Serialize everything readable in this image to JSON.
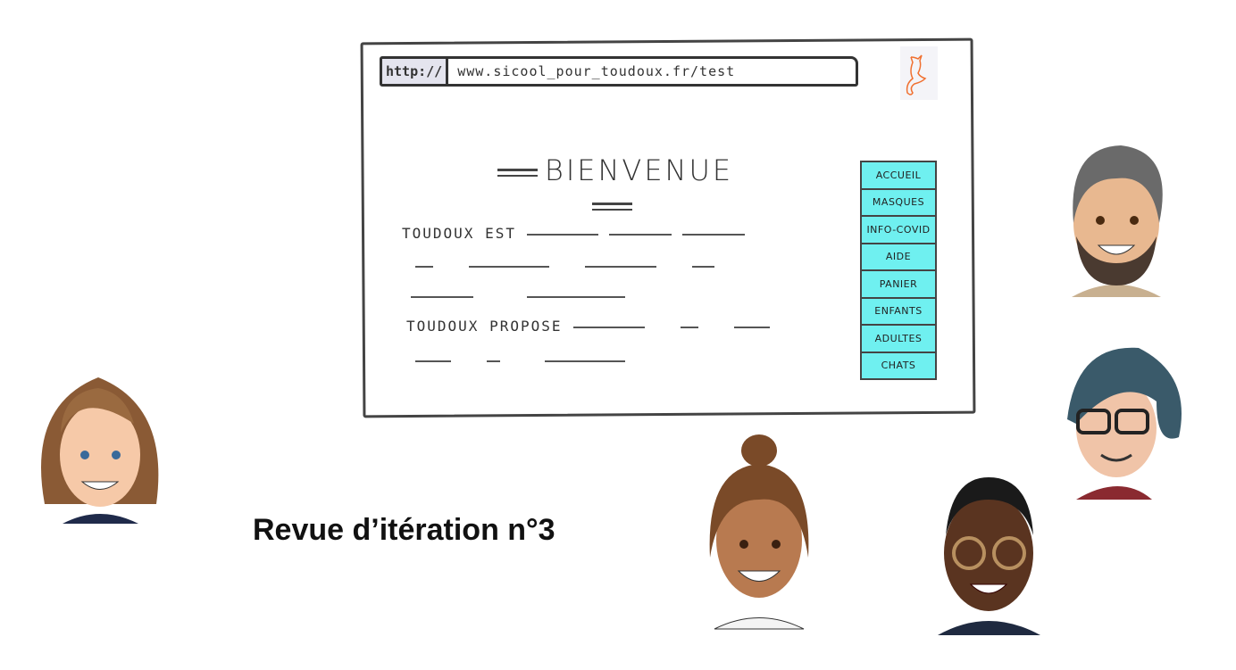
{
  "mockup": {
    "url_protocol": "http://",
    "url_address": "www.sicool_pour_toudoux.fr/test",
    "welcome_heading": "BIENVENUE",
    "text_line_1": "TOUDOUX EST",
    "text_line_2": "TOUDOUX PROPOSE",
    "logo_icon": "cat-icon",
    "logo_color": "#f07030",
    "menu_color": "#6ff0f0",
    "menu_items": [
      "ACCUEIL",
      "MASQUES",
      "INFO-COVID",
      "AIDE",
      "PANIER",
      "ENFANTS",
      "ADULTES",
      "CHATS"
    ]
  },
  "slide_title": "Revue d’itération n°3"
}
